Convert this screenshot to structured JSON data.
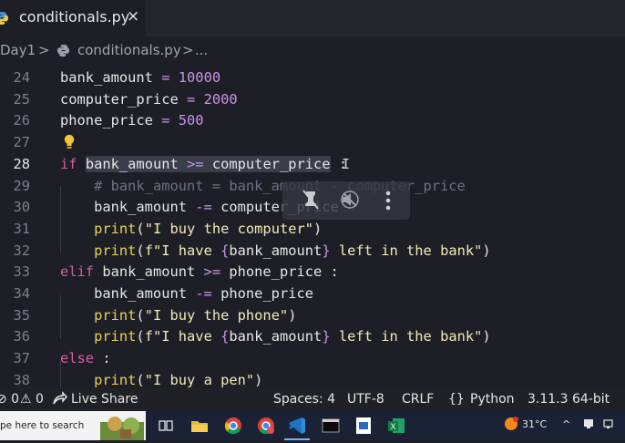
{
  "tab": {
    "filename": "conditionals.py",
    "close": "×",
    "icon": "python-file-icon"
  },
  "breadcrumb": {
    "folder": "Day1",
    "sep1": ">",
    "file": "conditionals.py",
    "sep2": ">",
    "more": "..."
  },
  "editor": {
    "active_line": 28,
    "lines": [
      {
        "n": "24",
        "tokens": [
          {
            "t": "bank_amount ",
            "c": ""
          },
          {
            "t": "=",
            "c": "op"
          },
          {
            "t": " ",
            "c": ""
          },
          {
            "t": "10000",
            "c": "num"
          }
        ]
      },
      {
        "n": "25",
        "tokens": [
          {
            "t": "computer_price ",
            "c": ""
          },
          {
            "t": "=",
            "c": "op"
          },
          {
            "t": " ",
            "c": ""
          },
          {
            "t": "2000",
            "c": "num"
          }
        ]
      },
      {
        "n": "26",
        "tokens": [
          {
            "t": "phone_price ",
            "c": ""
          },
          {
            "t": "=",
            "c": "op"
          },
          {
            "t": " ",
            "c": ""
          },
          {
            "t": "500",
            "c": "num"
          }
        ]
      },
      {
        "n": "27",
        "tokens": []
      },
      {
        "n": "28",
        "tokens": [
          {
            "t": "if",
            "c": "kw"
          },
          {
            "t": " ",
            "c": ""
          },
          {
            "t": "bank_amount ",
            "c": "hl"
          },
          {
            "t": ">=",
            "c": "op hl"
          },
          {
            "t": " computer_price",
            "c": "hl"
          },
          {
            "t": " :",
            "c": ""
          }
        ]
      },
      {
        "n": "29",
        "tokens": [
          {
            "t": "    ",
            "c": ""
          },
          {
            "t": "# bank_amount = bank_amount - computer_price",
            "c": "cmt"
          }
        ]
      },
      {
        "n": "30",
        "tokens": [
          {
            "t": "    bank_amount ",
            "c": ""
          },
          {
            "t": "-=",
            "c": "op"
          },
          {
            "t": " computer_price",
            "c": ""
          }
        ]
      },
      {
        "n": "31",
        "tokens": [
          {
            "t": "    ",
            "c": ""
          },
          {
            "t": "print",
            "c": "fn"
          },
          {
            "t": "(",
            "c": ""
          },
          {
            "t": "\"I buy the computer\"",
            "c": "str"
          },
          {
            "t": ")",
            "c": ""
          }
        ]
      },
      {
        "n": "32",
        "tokens": [
          {
            "t": "    ",
            "c": ""
          },
          {
            "t": "print",
            "c": "fn"
          },
          {
            "t": "(",
            "c": ""
          },
          {
            "t": "f\"I have ",
            "c": "str"
          },
          {
            "t": "{",
            "c": "op"
          },
          {
            "t": "bank_amount",
            "c": ""
          },
          {
            "t": "}",
            "c": "op"
          },
          {
            "t": " left in the bank\"",
            "c": "str"
          },
          {
            "t": ")",
            "c": ""
          }
        ]
      },
      {
        "n": "33",
        "tokens": [
          {
            "t": "elif",
            "c": "kw"
          },
          {
            "t": " bank_amount ",
            "c": ""
          },
          {
            "t": ">=",
            "c": "op"
          },
          {
            "t": " phone_price :",
            "c": ""
          }
        ]
      },
      {
        "n": "34",
        "tokens": [
          {
            "t": "    bank_amount ",
            "c": ""
          },
          {
            "t": "-=",
            "c": "op"
          },
          {
            "t": " phone_price",
            "c": ""
          }
        ]
      },
      {
        "n": "35",
        "tokens": [
          {
            "t": "    ",
            "c": ""
          },
          {
            "t": "print",
            "c": "fn"
          },
          {
            "t": "(",
            "c": ""
          },
          {
            "t": "\"I buy the phone\"",
            "c": "str"
          },
          {
            "t": ")",
            "c": ""
          }
        ]
      },
      {
        "n": "36",
        "tokens": [
          {
            "t": "    ",
            "c": ""
          },
          {
            "t": "print",
            "c": "fn"
          },
          {
            "t": "(",
            "c": ""
          },
          {
            "t": "f\"I have ",
            "c": "str"
          },
          {
            "t": "{",
            "c": "op"
          },
          {
            "t": "bank_amount",
            "c": ""
          },
          {
            "t": "}",
            "c": "op"
          },
          {
            "t": " left in the bank\"",
            "c": "str"
          },
          {
            "t": ")",
            "c": ""
          }
        ]
      },
      {
        "n": "37",
        "tokens": [
          {
            "t": "else",
            "c": "kw"
          },
          {
            "t": " :",
            "c": ""
          }
        ]
      },
      {
        "n": "38",
        "tokens": [
          {
            "t": "    ",
            "c": ""
          },
          {
            "t": "print",
            "c": "fn"
          },
          {
            "t": "(",
            "c": ""
          },
          {
            "t": "\"I buy a pen\"",
            "c": "str"
          },
          {
            "t": ")",
            "c": ""
          }
        ]
      }
    ]
  },
  "statusbar": {
    "problems": "⊘ 0",
    "warnings": "⚠ 0",
    "live_share": "Live Share",
    "spaces": "Spaces: 4",
    "encoding": "UTF-8",
    "eol": "CRLF",
    "language": "Python",
    "interpreter": "3.11.3 64-bit"
  },
  "taskbar": {
    "search_placeholder": "pe here to search",
    "temperature": "31°C"
  },
  "colors": {
    "editor_bg": "#1e1f26",
    "keyword": "#d35fa0",
    "function": "#e9d15a",
    "number": "#c794ea"
  }
}
